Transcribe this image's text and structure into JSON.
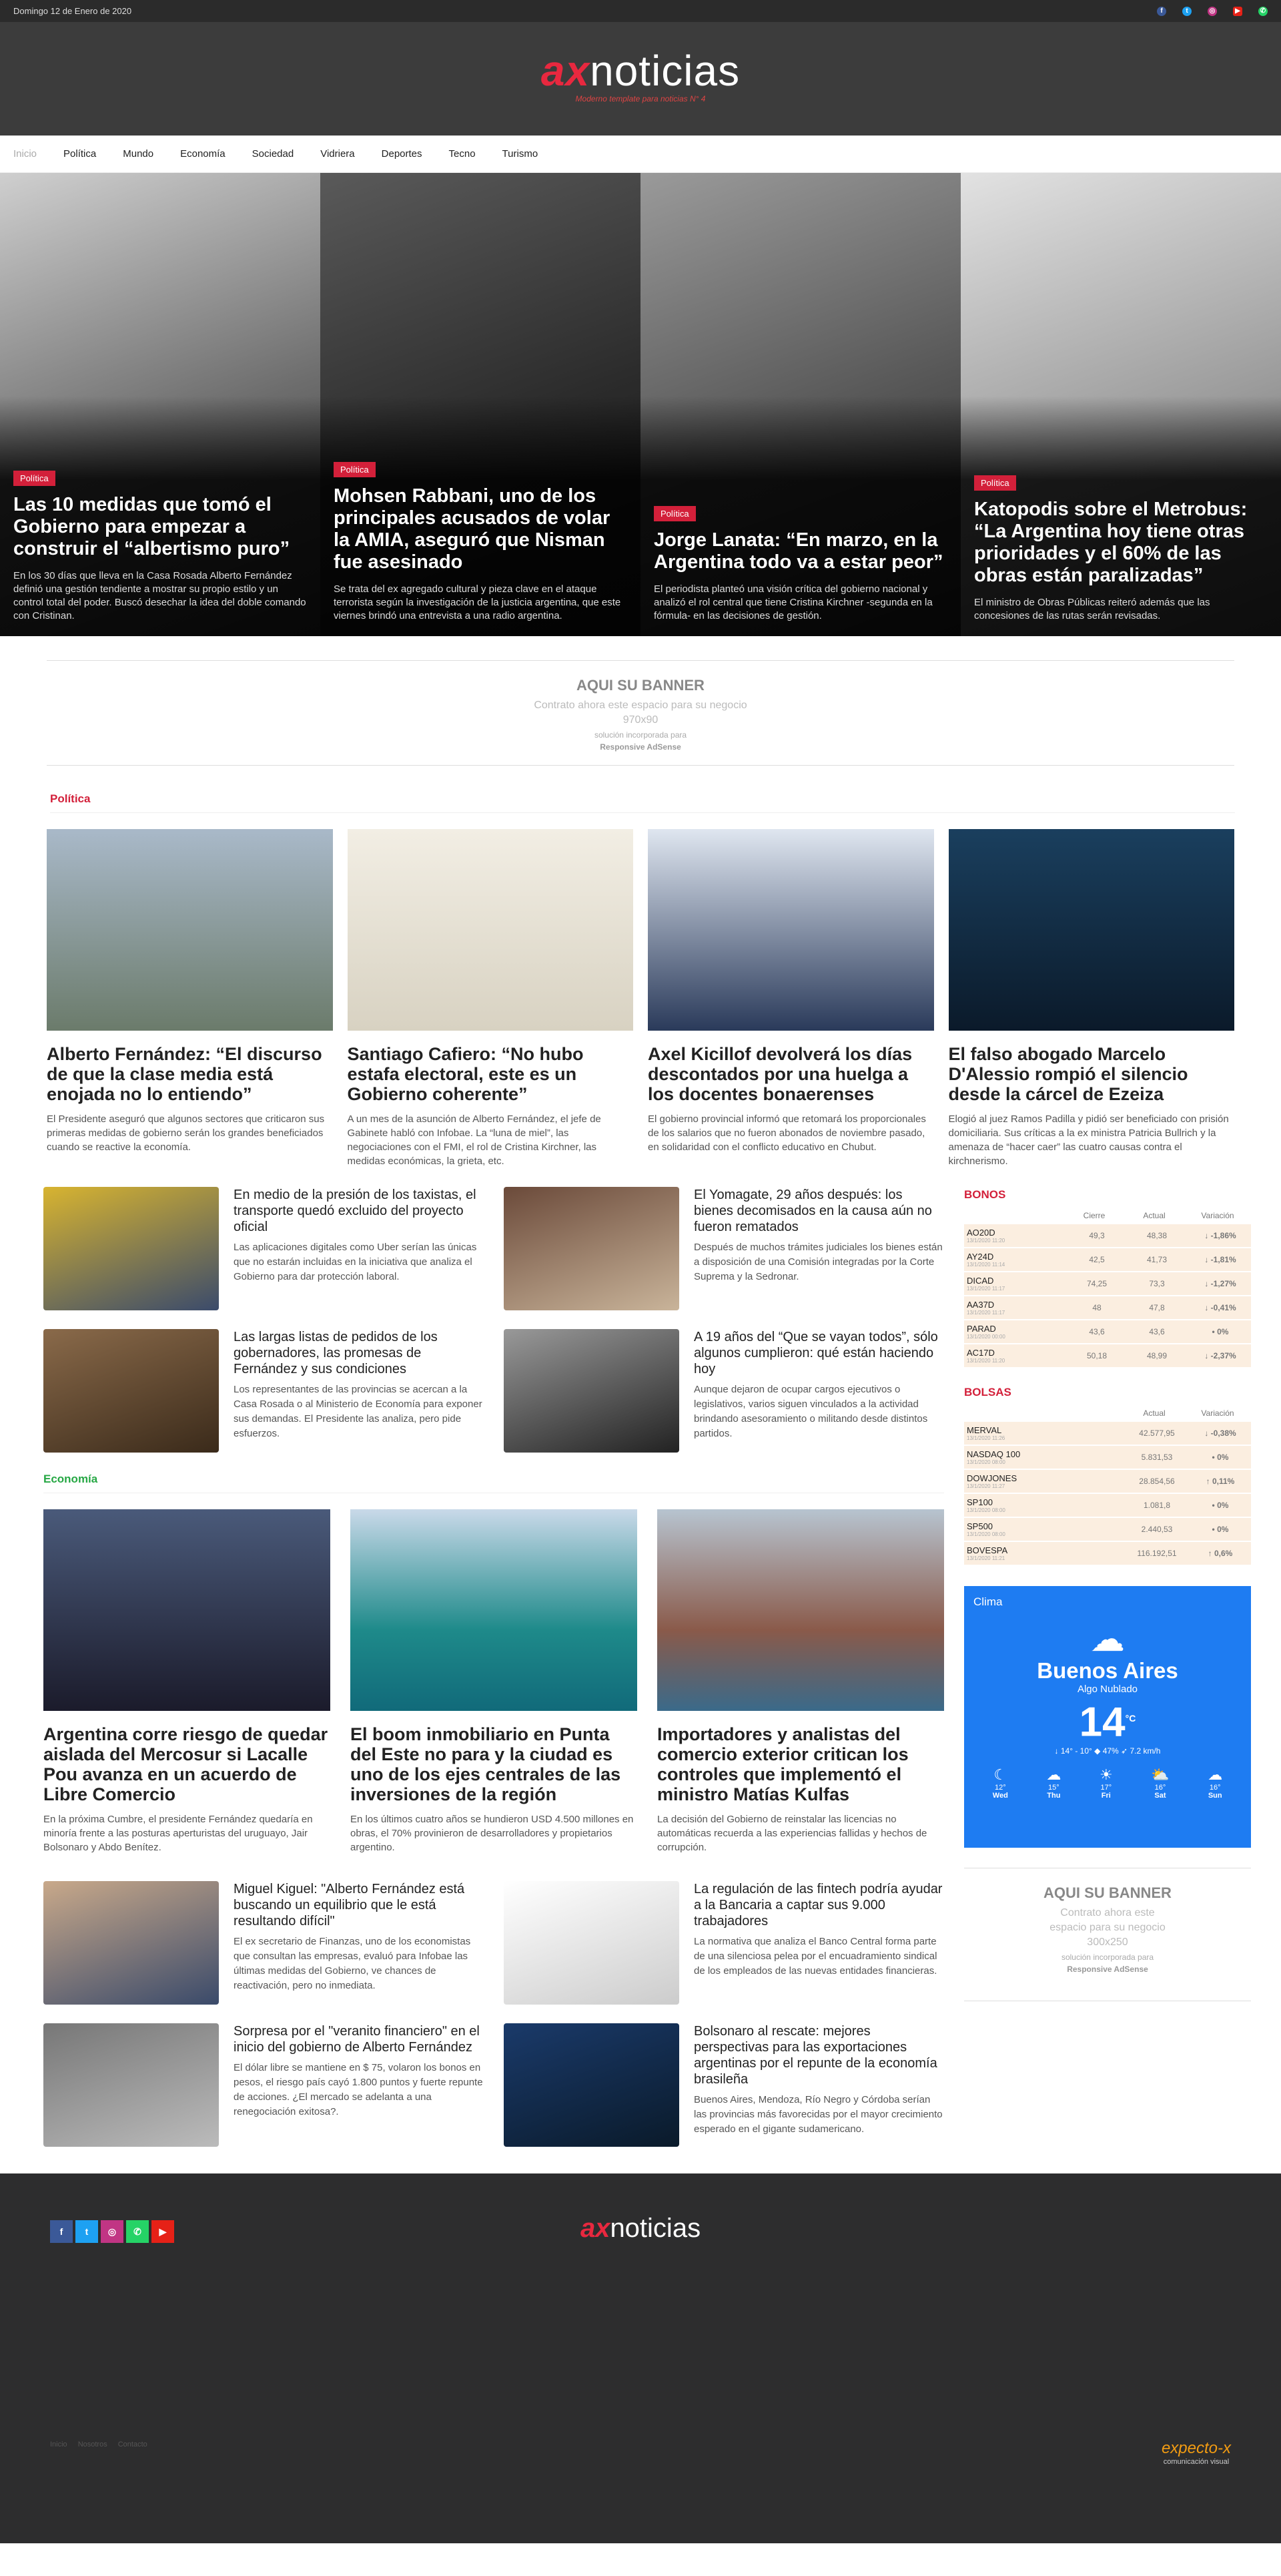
{
  "topbar": {
    "date": "Domingo 12 de Enero de 2020"
  },
  "header": {
    "logo_ax": "ax",
    "logo_rest": "noticias",
    "tagline": "Moderno template para noticias N° 4"
  },
  "nav": [
    "Inicio",
    "Política",
    "Mundo",
    "Economía",
    "Sociedad",
    "Vidriera",
    "Deportes",
    "Tecno",
    "Turismo"
  ],
  "hero": [
    {
      "tag": "Política",
      "title": "Las 10 medidas que tomó el Gobierno para empezar a construir el “albertismo puro”",
      "summary": "En los 30 días que lleva en la Casa Rosada Alberto Fernández definió una gestión tendiente a mostrar su propio estilo y un control total del poder. Buscó desechar la idea del doble comando con Cristinan."
    },
    {
      "tag": "Política",
      "title": "Mohsen Rabbani, uno de los principales acusados de volar la AMIA, aseguró que Nisman fue asesinado",
      "summary": "Se trata del ex agregado cultural y pieza clave en el ataque terrorista según la investigación de la justicia argentina, que este viernes brindó una entrevista a una radio argentina."
    },
    {
      "tag": "Política",
      "title": "Jorge Lanata: “En marzo, en la Argentina todo va a estar peor”",
      "summary": "El periodista planteó una visión crítica del gobierno nacional y analizó el rol central que tiene Cristina Kirchner -segunda en la fórmula- en las decisiones de gestión."
    },
    {
      "tag": "Política",
      "title": "Katopodis sobre el Metrobus: “La Argentina hoy tiene otras prioridades y el 60% de las obras están paralizadas”",
      "summary": "El ministro de Obras Públicas reiteró además que las concesiones de las rutas serán revisadas."
    }
  ],
  "banner": {
    "title": "AQUI SU BANNER",
    "line1": "Contrato ahora este espacio para su negocio",
    "size": "970x90",
    "line2": "solución incorporada para",
    "line3": "Responsive AdSense"
  },
  "politica": {
    "title": "Política",
    "cards": [
      {
        "title": "Alberto Fernández: “El discurso de que la clase media está enojada no lo entiendo”",
        "summary": "El Presidente aseguró que algunos sectores que criticaron sus primeras medidas de gobierno serán los grandes beneficiados cuando se reactive la economía."
      },
      {
        "title": "Santiago Cafiero: “No hubo estafa electoral, este es un Gobierno coherente”",
        "summary": "A un mes de la asunción de Alberto Fernández, el jefe de Gabinete habló con Infobae. La “luna de miel”, las negociaciones con el FMI, el rol de Cristina Kirchner, las medidas económicas, la grieta, etc."
      },
      {
        "title": "Axel Kicillof devolverá los días descontados por una huelga a los docentes bonaerenses",
        "summary": "El gobierno provincial informó que retomará los proporcionales de los salarios que no fueron abonados de noviembre pasado, en solidaridad con el conflicto educativo en Chubut."
      },
      {
        "title": "El falso abogado Marcelo D'Alessio rompió el silencio desde la cárcel de Ezeiza",
        "summary": "Elogió al juez Ramos Padilla y pidió ser beneficiado con prisión domiciliaria. Sus críticas a la ex ministra Patricia Bullrich y la amenaza de “hacer caer” las cuatro causas contra el kirchnerismo."
      }
    ],
    "small": [
      {
        "title": "En medio de la presión de los taxistas, el transporte quedó excluido del proyecto oficial",
        "summary": "Las aplicaciones digitales como Uber serían las únicas que no estarán incluidas en la iniciativa que analiza el Gobierno para dar protección laboral."
      },
      {
        "title": "El Yomagate, 29 años después: los bienes decomisados en la causa aún no fueron rematados",
        "summary": "Después de muchos trámites judiciales los bienes están a disposición de una Comisión integradas por la Corte Suprema y la Sedronar."
      },
      {
        "title": "Las largas listas de pedidos de los gobernadores, las promesas de Fernández y sus condiciones",
        "summary": "Los representantes de las provincias se acercan a la Casa Rosada o al Ministerio de Economía para exponer sus demandas. El Presidente las analiza, pero pide esfuerzos."
      },
      {
        "title": "A 19 años del “Que se vayan todos”, sólo algunos cumplieron: qué están haciendo hoy",
        "summary": "Aunque dejaron de ocupar cargos ejecutivos o legislativos, varios siguen vinculados a la actividad brindando asesoramiento o militando desde distintos partidos."
      }
    ]
  },
  "economia": {
    "title": "Economía",
    "cards": [
      {
        "title": "Argentina corre riesgo de quedar aislada del Mercosur si Lacalle Pou avanza en un acuerdo de Libre Comercio",
        "summary": "En la próxima Cumbre, el presidente Fernández quedaría en minoría frente a las posturas aperturistas del uruguayo, Jair Bolsonaro y Abdo Benítez."
      },
      {
        "title": "El boom inmobiliario en Punta del Este no para y la ciudad es uno de los ejes centrales de las inversiones de la región",
        "summary": "En los últimos cuatro años se hundieron USD 4.500 millones en obras, el 70% provinieron de desarrolladores y propietarios argentino."
      },
      {
        "title": "Importadores y analistas del comercio exterior critican los controles que implementó el ministro Matías Kulfas",
        "summary": "La decisión del Gobierno de reinstalar las licencias no automáticas recuerda a las experiencias fallidas y hechos de corrupción."
      }
    ],
    "small": [
      {
        "title": "Miguel Kiguel: \"Alberto Fernández está buscando un equilibrio que le está resultando difícil\"",
        "summary": "El ex secretario de Finanzas, uno de los economistas que consultan las empresas, evaluó para Infobae las últimas medidas del Gobierno, ve chances de reactivación, pero no inmediata."
      },
      {
        "title": "La regulación de las fintech podría ayudar a la Bancaria a captar sus 9.000 trabajadores",
        "summary": "La normativa que analiza el Banco Central forma parte de una silenciosa pelea por el encuadramiento sindical de los empleados de las nuevas entidades financieras."
      },
      {
        "title": "Sorpresa por el \"veranito financiero\" en el inicio del gobierno de Alberto Fernández",
        "summary": "El dólar libre se mantiene en $ 75, volaron los bonos en pesos, el riesgo país cayó 1.800 puntos y fuerte repunte de acciones. ¿El mercado se adelanta a una renegociación exitosa?."
      },
      {
        "title": "Bolsonaro al rescate: mejores perspectivas para las exportaciones argentinas por el repunte de la economía brasileña",
        "summary": "Buenos Aires, Mendoza, Río Negro y Córdoba serían las provincias más favorecidas por el mayor crecimiento esperado en el gigante sudamericano."
      }
    ]
  },
  "bonos": {
    "title": "BONOS",
    "headers": [
      "",
      "Cierre",
      "Actual",
      "Variación"
    ],
    "rows": [
      {
        "name": "AO20D",
        "date": "13/1/2020 11:20",
        "close": "49,3",
        "now": "48,38",
        "var": "↓ -1,86%",
        "cls": "neg"
      },
      {
        "name": "AY24D",
        "date": "13/1/2020 11:14",
        "close": "42,5",
        "now": "41,73",
        "var": "↓ -1,81%",
        "cls": "neg"
      },
      {
        "name": "DICAD",
        "date": "13/1/2020 11:17",
        "close": "74,25",
        "now": "73,3",
        "var": "↓ -1,27%",
        "cls": "neg"
      },
      {
        "name": "AA37D",
        "date": "13/1/2020 11:17",
        "close": "48",
        "now": "47,8",
        "var": "↓ -0,41%",
        "cls": "neg"
      },
      {
        "name": "PARAD",
        "date": "13/1/2020 00:00",
        "close": "43,6",
        "now": "43,6",
        "var": "• 0%",
        "cls": "zero"
      },
      {
        "name": "AC17D",
        "date": "13/1/2020 11:20",
        "close": "50,18",
        "now": "48,99",
        "var": "↓ -2,37%",
        "cls": "neg"
      }
    ]
  },
  "bolsas": {
    "title": "BOLSAS",
    "headers": [
      "",
      "",
      "Actual",
      "Variación"
    ],
    "rows": [
      {
        "name": "MERVAL",
        "date": "13/1/2020 11:26",
        "close": "",
        "now": "42.577,95",
        "var": "↓ -0,38%",
        "cls": "neg"
      },
      {
        "name": "NASDAQ 100",
        "date": "13/1/2020 08:00",
        "close": "",
        "now": "5.831,53",
        "var": "• 0%",
        "cls": "zero"
      },
      {
        "name": "DOWJONES",
        "date": "13/1/2020 11:27",
        "close": "",
        "now": "28.854,56",
        "var": "↑ 0,11%",
        "cls": "pos"
      },
      {
        "name": "SP100",
        "date": "13/1/2020 08:00",
        "close": "",
        "now": "1.081,8",
        "var": "• 0%",
        "cls": "zero"
      },
      {
        "name": "SP500",
        "date": "13/1/2020 08:00",
        "close": "",
        "now": "2.440,53",
        "var": "• 0%",
        "cls": "zero"
      },
      {
        "name": "BOVESPA",
        "date": "13/1/2020 11:21",
        "close": "",
        "now": "116.192,51",
        "var": "↑ 0,6%",
        "cls": "pos"
      }
    ]
  },
  "weather": {
    "label": "Clima",
    "city": "Buenos Aires",
    "condition": "Algo Nublado",
    "temp": "14",
    "unit": "°C",
    "info": "↓ 14° - 10° ◆ 47% ➶ 7.2 km/h",
    "days": [
      {
        "temp": "12°",
        "day": "Wed"
      },
      {
        "temp": "15°",
        "day": "Thu"
      },
      {
        "temp": "17°",
        "day": "Fri"
      },
      {
        "temp": "16°",
        "day": "Sat"
      },
      {
        "temp": "16°",
        "day": "Sun"
      }
    ]
  },
  "banner2": {
    "title": "AQUI SU BANNER",
    "line1": "Contrato ahora este",
    "line1b": "espacio para su negocio",
    "size": "300x250",
    "line2": "solución incorporada para",
    "line3": "Responsive AdSense"
  },
  "footer": {
    "logo_ax": "ax",
    "logo_rest": "noticias",
    "links": [
      "Inicio",
      "Nosotros",
      "Contacto"
    ],
    "credit": "expecto-x",
    "credit_sub": "comunicación visual"
  },
  "colors": {
    "accent": "#d3203a",
    "dark": "#3c3c3c",
    "weather": "#1e7cf2"
  }
}
